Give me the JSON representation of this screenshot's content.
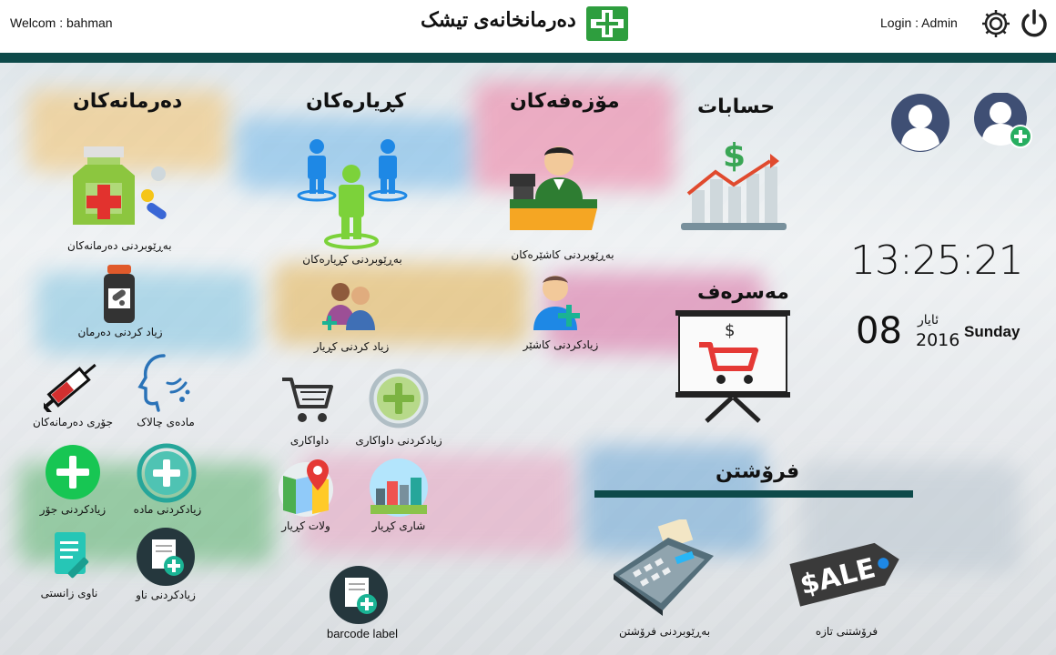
{
  "header": {
    "welcome": "Welcom : bahman",
    "title": "دەرمانخانەی تیشک",
    "login": "Login : Admin"
  },
  "sections": {
    "medicines": "دەرمانەکان",
    "customers": "کڕیارەکان",
    "employees": "مۆزەفەکان",
    "accounts": "حسابات",
    "expenses": "مەسرەف",
    "sales": "فرۆشتن"
  },
  "tiles": {
    "manage_medicines": "بەڕێوبردنی دەرمانەکان",
    "add_medicine": "زیاد کردنی دەرمان",
    "medicine_type": "جۆری دەرمانەکان",
    "active_substance": "مادەی چالاک",
    "add_type": "زیادکردنی جۆر",
    "add_substance": "زیادکردنی مادە",
    "scientific_name": "ناوی زانستی",
    "add_name": "زیادکردنی ناو",
    "barcode_label": "barcode label",
    "manage_customers": "بەڕێوبردنی کڕیارەکان",
    "add_customer": "زیاد کردنی کڕیار",
    "requests": "داواکاری",
    "add_request": "زیادکردنی داواکاری",
    "customer_country": "ولات کڕیار",
    "customer_city": "شاری کڕیار",
    "manage_cashiers": "بەڕێوبردنی کاشێرەکان",
    "add_cashier": "زیادکردنی کاشێر",
    "manage_sales": "بەڕێوبردنی فرۆشتن",
    "new_sale": "فرۆشتنی تازە"
  },
  "clock": {
    "time": "13:25:21",
    "day": "08",
    "month": "ئایار",
    "year": "2016",
    "weekday": "Sunday"
  },
  "icons": {
    "settings": "gear-icon",
    "power": "power-icon",
    "logo": "pharmacy-cross-icon"
  },
  "colors": {
    "teal": "#0e4a4a",
    "green": "#2ecc71",
    "accent_green": "#27ae60"
  }
}
